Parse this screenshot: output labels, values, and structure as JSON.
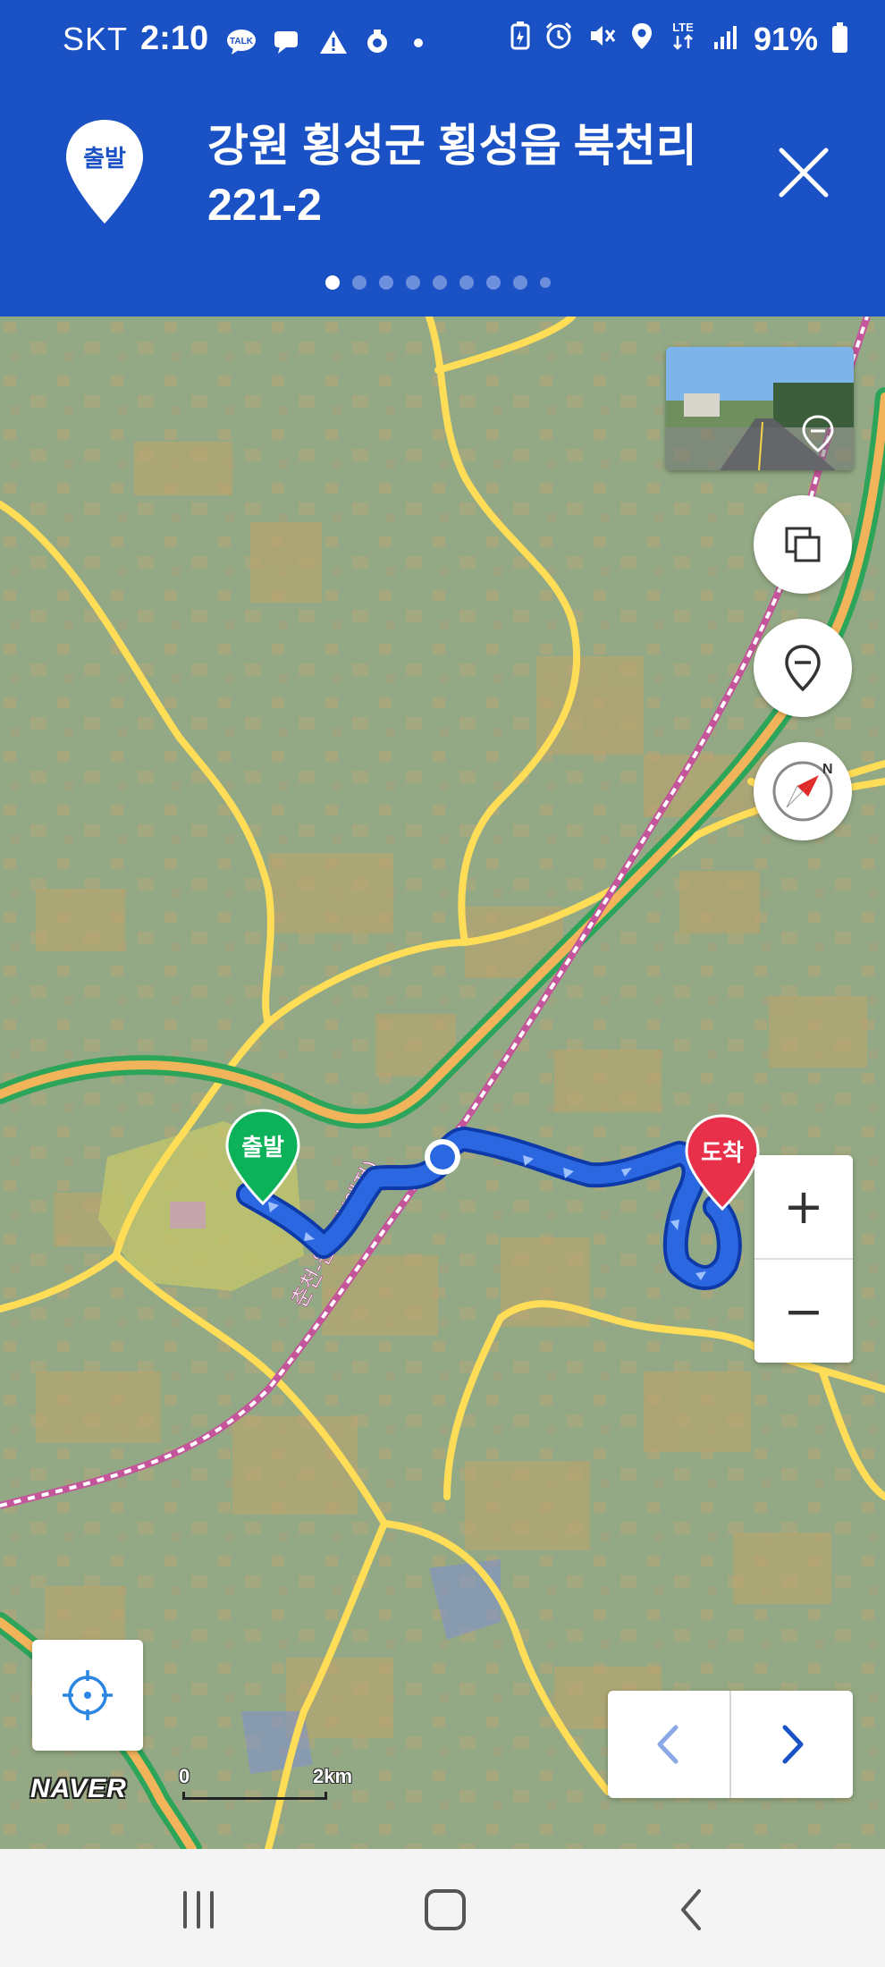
{
  "status_bar": {
    "carrier": "SKT",
    "time": "2:10",
    "battery": "91%",
    "network": "LTE",
    "left_icons": [
      "kakaotalk-icon",
      "chat-icon",
      "warning-icon",
      "location-alert-icon",
      "dot-icon"
    ],
    "right_icons": [
      "battery-saver-icon",
      "alarm-icon",
      "mute-icon",
      "location-icon",
      "lte-icon",
      "signal-icon"
    ]
  },
  "header": {
    "badge_label": "출발",
    "title": "강원 횡성군 횡성읍 북천리\n221-2",
    "close_icon": "close-icon",
    "page_dots": {
      "count": 9,
      "active_index": 0
    },
    "colors": {
      "background": "#1a51c5",
      "text": "#ffffff"
    }
  },
  "map": {
    "markers": {
      "start_label": "출발",
      "end_label": "도착",
      "start_color": "#0cb25a",
      "end_color": "#e8304a"
    },
    "railway_label": "춘천-원주간(예정)",
    "route_color": "#1e5fd8",
    "controls": {
      "street_view_icon": "street-view-thumbnail",
      "layers_icon": "layers-icon",
      "pin_icon": "map-pin-icon",
      "compass_icon": "compass-icon",
      "compass_letter": "N",
      "zoom_in": "+",
      "zoom_out": "−",
      "locate_icon": "crosshair-icon"
    },
    "logo": "NAVER",
    "scale": {
      "start": "0",
      "end": "2km"
    },
    "step_nav": {
      "prev_icon": "chevron-left-icon",
      "next_icon": "chevron-right-icon"
    }
  },
  "nav_bar": {
    "recent_icon": "recent-apps-icon",
    "home_icon": "home-icon",
    "back_icon": "back-icon"
  }
}
